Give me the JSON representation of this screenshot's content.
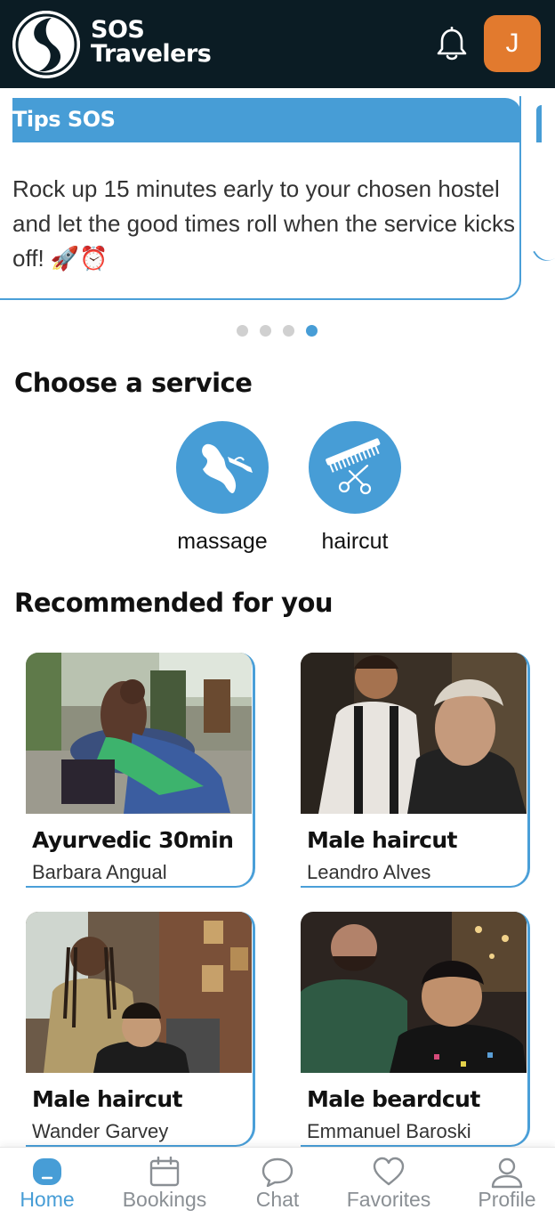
{
  "header": {
    "app_name_line1": "SOS",
    "app_name_line2": "Travelers",
    "avatar_initial": "J",
    "icons": [
      "logo-icon",
      "bell-icon"
    ],
    "colors": {
      "header_bg": "#0b1c24",
      "avatar_bg": "#e27a2e",
      "accent": "#479dd6"
    }
  },
  "tips": {
    "title": "Tips SOS",
    "text": "Rock up 15 minutes early to your chosen hostel and let the good times roll when the service kicks off! 🚀⏰",
    "pager": {
      "total": 4,
      "active_index": 3
    }
  },
  "services": {
    "title": "Choose a service",
    "items": [
      {
        "label": "massage",
        "icon": "massage-icon"
      },
      {
        "label": "haircut",
        "icon": "haircut-icon"
      }
    ]
  },
  "recommended": {
    "title": "Recommended for you",
    "cards": [
      {
        "title": "Ayurvedic 30min",
        "provider": "Barbara Angual",
        "image": "massage-photo"
      },
      {
        "title": "Male haircut",
        "provider": "Leandro Alves",
        "image": "barber-photo"
      },
      {
        "title": "Male haircut",
        "provider": "Wander Garvey",
        "image": "barbershop-photo"
      },
      {
        "title": "Male beardcut",
        "provider": "Emmanuel Baroski",
        "image": "beardcut-photo"
      }
    ]
  },
  "nav": {
    "items": [
      {
        "label": "Home",
        "icon": "home-icon",
        "active": true
      },
      {
        "label": "Bookings",
        "icon": "calendar-icon",
        "active": false
      },
      {
        "label": "Chat",
        "icon": "chat-icon",
        "active": false
      },
      {
        "label": "Favorites",
        "icon": "heart-icon",
        "active": false
      },
      {
        "label": "Profile",
        "icon": "user-icon",
        "active": false
      }
    ]
  }
}
